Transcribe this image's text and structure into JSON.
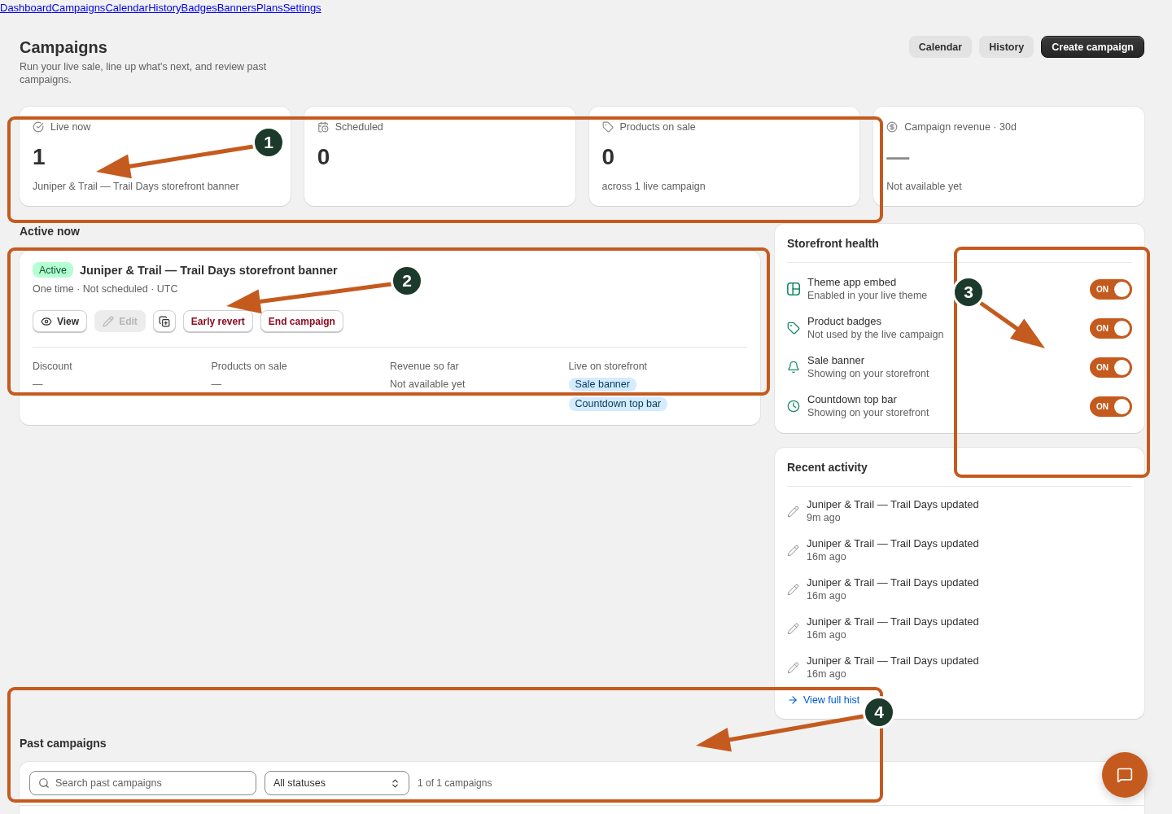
{
  "nav": [
    "Dashboard",
    "Campaigns",
    "Calendar",
    "History",
    "Badges",
    "Banners",
    "Plans",
    "Settings"
  ],
  "header": {
    "title": "Campaigns",
    "subtitle": "Run your live sale, line up what's next, and review past campaigns.",
    "buttons": [
      {
        "label": "Calendar",
        "kind": "secondary"
      },
      {
        "label": "History",
        "kind": "secondary"
      },
      {
        "label": "Create campaign",
        "kind": "primary"
      }
    ]
  },
  "stats": [
    {
      "label": "Live now",
      "value": "1",
      "caption": "Juniper & Trail — Trail Days storefront banner",
      "muted": false
    },
    {
      "label": "Scheduled",
      "value": "0",
      "muted": false
    },
    {
      "label": "Products on sale",
      "value": "0",
      "caption": "across 1 live campaign",
      "muted": false
    },
    {
      "label": "Campaign revenue · 30d",
      "value": "—",
      "caption": "Not available yet",
      "muted": true
    }
  ],
  "active_now": {
    "heading": "Active now",
    "campaign": {
      "status": "Active",
      "title": "Juniper & Trail — Trail Days storefront banner",
      "meta": "One time · Not scheduled · UTC",
      "actions": [
        {
          "label": "View",
          "kind": "default",
          "disabled": false
        },
        {
          "label": "Edit",
          "kind": "default",
          "disabled": true
        },
        {
          "kind": "icon",
          "disabled": false
        },
        {
          "label": "Early revert",
          "kind": "critical",
          "disabled": false
        },
        {
          "label": "End campaign",
          "kind": "critical",
          "disabled": false
        }
      ],
      "details": [
        {
          "label": "Discount",
          "kind": "text",
          "value": "—"
        },
        {
          "label": "Products on sale",
          "kind": "text",
          "value": "—"
        },
        {
          "label": "Revenue so far",
          "kind": "text",
          "value": "Not available yet"
        },
        {
          "label": "Live on storefront",
          "kind": "tags",
          "tags": [
            "Sale banner",
            "Countdown top bar"
          ]
        }
      ]
    }
  },
  "storefront_health": {
    "title": "Storefront health",
    "items": [
      {
        "title": "Theme app embed",
        "subtitle": "Enabled in your live theme",
        "on": true,
        "toggle_label": "ON"
      },
      {
        "title": "Product badges",
        "subtitle": "Not used by the live campaign",
        "on": true,
        "toggle_label": "ON"
      },
      {
        "title": "Sale banner",
        "subtitle": "Showing on your storefront",
        "on": true,
        "toggle_label": "ON"
      },
      {
        "title": "Countdown top bar",
        "subtitle": "Showing on your storefront",
        "on": true,
        "toggle_label": "ON"
      }
    ]
  },
  "recent_activity": {
    "title": "Recent activity",
    "items": [
      {
        "text": "Juniper & Trail — Trail Days updated",
        "time": "9m ago"
      },
      {
        "text": "Juniper & Trail — Trail Days updated",
        "time": "16m ago"
      },
      {
        "text": "Juniper & Trail — Trail Days updated",
        "time": "16m ago"
      },
      {
        "text": "Juniper & Trail — Trail Days updated",
        "time": "16m ago"
      },
      {
        "text": "Juniper & Trail — Trail Days updated",
        "time": "16m ago"
      }
    ],
    "link": "View full hist"
  },
  "past_campaigns": {
    "heading": "Past campaigns",
    "search": {
      "placeholder": "Search past campaigns"
    },
    "status_filter": {
      "value": "All statuses"
    },
    "count": "1 of 1 campaigns"
  },
  "annotations": [
    {
      "label": "1"
    },
    {
      "label": "2"
    },
    {
      "label": "3"
    },
    {
      "label": "4"
    }
  ]
}
